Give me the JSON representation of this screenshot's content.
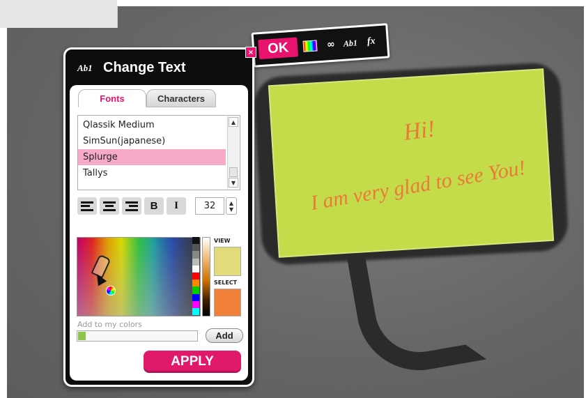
{
  "toolbar": {
    "ok_label": "OK",
    "icons": [
      "color-gradient-icon",
      "link-icon",
      "text-style-icon",
      "effects-icon"
    ],
    "text_style_label": "Ab1",
    "fx_label": "fx"
  },
  "dialog": {
    "close_label": "×",
    "title_icon": "Ab1",
    "title": "Change Text",
    "tabs": [
      {
        "label": "Fonts",
        "active": true
      },
      {
        "label": "Characters",
        "active": false
      }
    ],
    "fonts": [
      {
        "name": "Qlassik Medium"
      },
      {
        "name": "SimSun(japanese)"
      },
      {
        "name": "Splurge",
        "selected": true
      },
      {
        "name": "Tallys"
      }
    ],
    "format": {
      "align_left": "align-left-icon",
      "align_center": "align-center-icon",
      "align_right": "align-right-icon",
      "bold": "B",
      "italic": "I",
      "size": "32"
    },
    "color": {
      "view_label": "VIEW",
      "select_label": "SELECT",
      "view_color": "#e3db7a",
      "select_color": "#f07f38",
      "swatches": [
        "#111111",
        "#555555",
        "#888888",
        "#bbbbbb",
        "#ffffff",
        "#ff0000",
        "#ff8800",
        "#00cc00",
        "#0000ff",
        "#ff00ff",
        "#00ffff"
      ],
      "my_colors_label": "Add to my colors",
      "my_colors": [
        "#8ec64d"
      ],
      "add_label": "Add"
    },
    "apply_label": "APPLY"
  },
  "bubble": {
    "line1": "Hi!",
    "line2": "I am very glad to see You!",
    "fill": "#c4dc4a",
    "text_color": "#ea7a3a"
  }
}
